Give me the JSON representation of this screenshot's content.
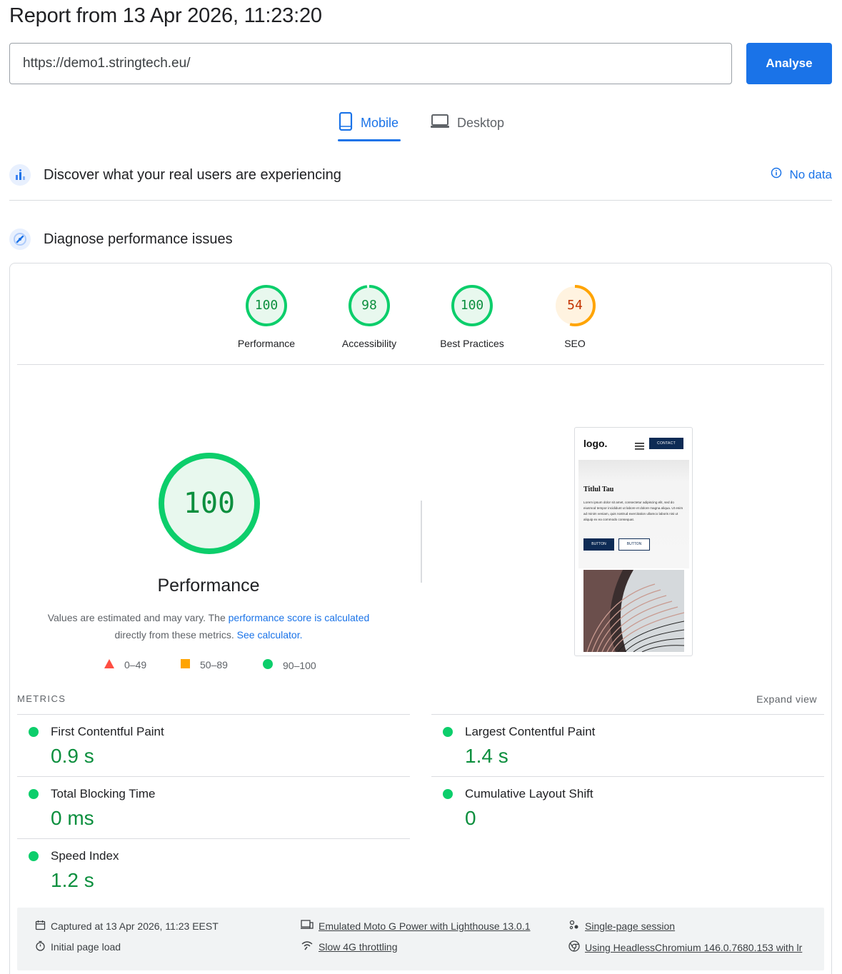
{
  "header": {
    "title": "Report from 13 Apr 2026, 11:23:20",
    "url_value": "https://demo1.stringtech.eu/",
    "analyse_label": "Analyse"
  },
  "tabs": [
    {
      "label": "Mobile",
      "icon": "phone-icon",
      "active": true
    },
    {
      "label": "Desktop",
      "icon": "laptop-icon",
      "active": false
    }
  ],
  "real_users": {
    "title": "Discover what your real users are experiencing",
    "status": "No data"
  },
  "diagnose": {
    "title": "Diagnose performance issues"
  },
  "scores": [
    {
      "label": "Performance",
      "value": "100",
      "fraction": 1.0,
      "color": "#0cce6b",
      "text_color": "#0c8f3e"
    },
    {
      "label": "Accessibility",
      "value": "98",
      "fraction": 0.98,
      "color": "#0cce6b",
      "text_color": "#0c8f3e"
    },
    {
      "label": "Best Practices",
      "value": "100",
      "fraction": 1.0,
      "color": "#0cce6b",
      "text_color": "#0c8f3e"
    },
    {
      "label": "SEO",
      "value": "54",
      "fraction": 0.54,
      "color": "#ffa400",
      "text_color": "#c33300"
    }
  ],
  "performance": {
    "score": "100",
    "label": "Performance",
    "note_prefix": "Values are estimated and may vary. The",
    "note_link1": "performance score is calculated",
    "note_middle": "directly from these metrics.",
    "note_link2": "See calculator."
  },
  "legend": [
    {
      "range": "0–49",
      "shape": "triangle",
      "color": "#ff4e42"
    },
    {
      "range": "50–89",
      "shape": "square",
      "color": "#ffa400"
    },
    {
      "range": "90–100",
      "shape": "circle",
      "color": "#0cce6b"
    }
  ],
  "screenshot": {
    "logo": "logo.",
    "contact": "CONTACT",
    "heading": "Titlul Tau",
    "paragraph": "Lorem ipsum dolor sit amet, consectetur adipiscing elit, sed do eiusmod tempor incididunt ut labore et dolore magna aliqua. Ut enim ad minim veniam, quis nostrud exercitation ullamco laboris nisi ut aliquip ex ea commodo consequat.",
    "button1": "BUTTON",
    "button2": "BUTTON"
  },
  "metrics": {
    "heading": "METRICS",
    "expand": "Expand view",
    "items": [
      {
        "name": "First Contentful Paint",
        "value": "0.9 s"
      },
      {
        "name": "Largest Contentful Paint",
        "value": "1.4 s"
      },
      {
        "name": "Total Blocking Time",
        "value": "0 ms"
      },
      {
        "name": "Cumulative Layout Shift",
        "value": "0"
      },
      {
        "name": "Speed Index",
        "value": "1.2 s"
      }
    ]
  },
  "footer": {
    "captured": "Captured at 13 Apr 2026, 11:23 EEST",
    "load": "Initial page load",
    "device": "Emulated Moto G Power with Lighthouse 13.0.1",
    "throttling": "Slow 4G throttling",
    "session": "Single-page session",
    "browser": "Using HeadlessChromium 146.0.7680.153 with lr"
  },
  "colors": {
    "accent": "#1a73e8",
    "pass": "#0cce6b",
    "average": "#ffa400",
    "fail": "#ff4e42"
  }
}
